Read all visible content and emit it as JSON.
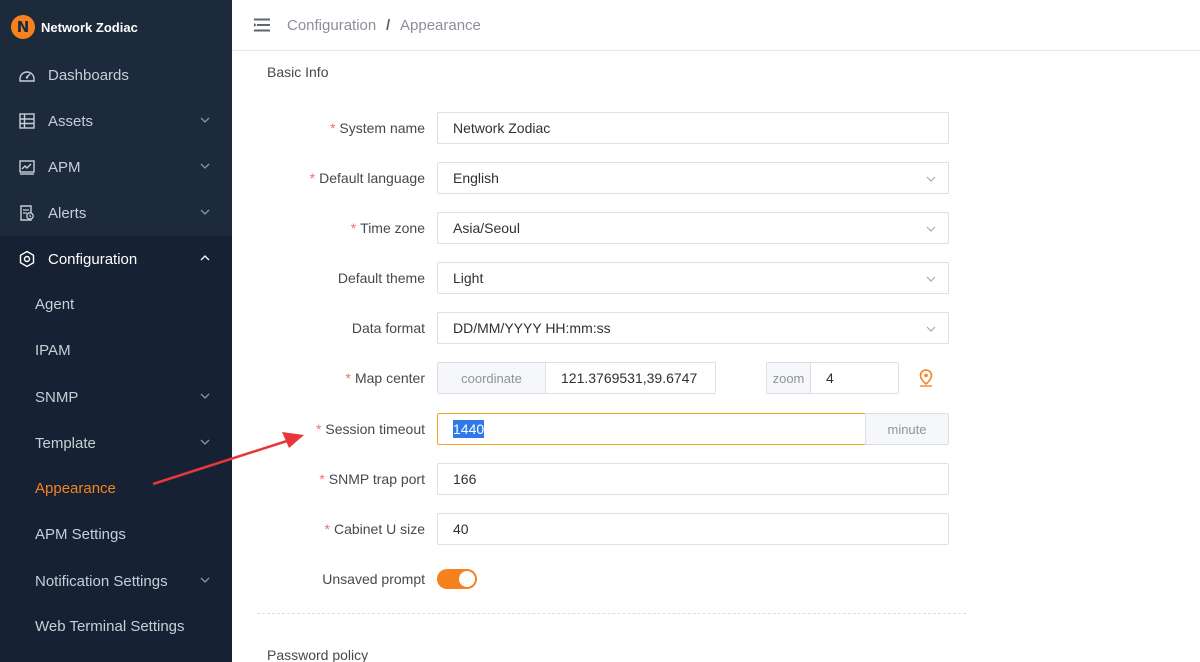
{
  "app": {
    "name": "Network Zodiac",
    "logo_letter": "N",
    "accent": "#f5821f"
  },
  "sidebar": {
    "items": [
      {
        "label": "Dashboards",
        "icon": "dashboard-icon"
      },
      {
        "label": "Assets",
        "icon": "table-icon",
        "expandable": true
      },
      {
        "label": "APM",
        "icon": "chart-icon",
        "expandable": true
      },
      {
        "label": "Alerts",
        "icon": "alert-icon",
        "expandable": true
      },
      {
        "label": "Configuration",
        "icon": "config-icon",
        "expandable": true,
        "expanded": true
      }
    ],
    "subitems": [
      {
        "label": "Agent"
      },
      {
        "label": "IPAM"
      },
      {
        "label": "SNMP",
        "expandable": true
      },
      {
        "label": "Template",
        "expandable": true
      },
      {
        "label": "Appearance",
        "active": true
      },
      {
        "label": "APM Settings"
      },
      {
        "label": "Notification Settings",
        "expandable": true
      },
      {
        "label": "Web Terminal Settings"
      }
    ]
  },
  "header": {
    "breadcrumb": [
      "Configuration",
      "Appearance"
    ],
    "separator": "/"
  },
  "form": {
    "section_basic": "Basic Info",
    "section_password": "Password policy",
    "system_name": {
      "label": "System name",
      "value": "Network Zodiac",
      "required": "*"
    },
    "default_language": {
      "label": "Default language",
      "value": "English",
      "required": "*"
    },
    "time_zone": {
      "label": "Time zone",
      "value": "Asia/Seoul",
      "required": "*"
    },
    "default_theme": {
      "label": "Default theme",
      "value": "Light"
    },
    "data_format": {
      "label": "Data format",
      "value": "DD/MM/YYYY HH:mm:ss"
    },
    "map_center": {
      "label": "Map center",
      "required": "*",
      "coordinate_addon": "coordinate",
      "coordinate_value": "121.3769531,39.6747",
      "zoom_addon": "zoom",
      "zoom_value": "4"
    },
    "session_timeout": {
      "label": "Session timeout",
      "required": "*",
      "value": "1440",
      "unit": "minute"
    },
    "snmp_trap_port": {
      "label": "SNMP trap port",
      "required": "*",
      "value": "166"
    },
    "cabinet_u_size": {
      "label": "Cabinet U size",
      "required": "*",
      "value": "40"
    },
    "unsaved_prompt": {
      "label": "Unsaved prompt",
      "enabled": true
    }
  }
}
